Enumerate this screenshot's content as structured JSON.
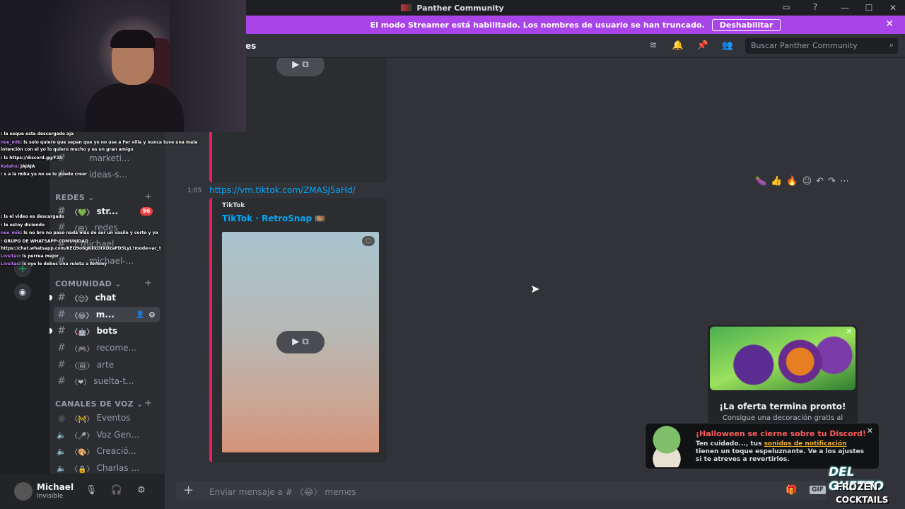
{
  "window": {
    "title": "Panther Community",
    "controls": [
      "—",
      "☐",
      "✕"
    ]
  },
  "banner": {
    "text": "El modo Streamer está habilitado. Los nombres de usuario se han truncado.",
    "button_label": "Deshabilitar",
    "close": "✕"
  },
  "header": {
    "channel_name": "es",
    "search_placeholder": "Buscar Panther Community",
    "icons": [
      "threads-icon",
      "bell-icon",
      "pin-icon",
      "members-icon",
      "search-icon"
    ]
  },
  "sidebar": {
    "top_channels": [
      {
        "label": "marketi..."
      },
      {
        "label": "ideas-s..."
      }
    ],
    "categories": [
      {
        "label": "REDES ⌄"
      },
      {
        "label": "COMUNIDAD ⌄"
      },
      {
        "label": "CANALES DE VOZ ⌄"
      }
    ],
    "redes_channels": [
      {
        "label": "str...",
        "emoji": "〈💚〉",
        "badge": "96"
      },
      {
        "label": "redes",
        "emoji": "〈▤〉"
      },
      {
        "label": "michael",
        "emoji": "〈"
      },
      {
        "label": "michael-...",
        "emoji": ""
      }
    ],
    "comunidad_channels": [
      {
        "label": "chat",
        "emoji": "〈😊〉"
      },
      {
        "label": "m...",
        "emoji": "〈😂〉"
      },
      {
        "label": "bots",
        "emoji": "〈🤖〉"
      },
      {
        "label": "recome...",
        "emoji": "〈🎮〉"
      },
      {
        "label": "arte",
        "emoji": "〈🖼〉"
      },
      {
        "label": "suelta-t...",
        "emoji": "〈❤〉"
      }
    ],
    "voice_channels": [
      {
        "label": "Eventos",
        "emoji": "〈🚧〉"
      },
      {
        "label": "Voz Gen...",
        "emoji": "〈🎤〉"
      },
      {
        "label": "Creació...",
        "emoji": "〈🎨〉"
      },
      {
        "label": "Charlas ...",
        "emoji": "〈🔒〉"
      }
    ]
  },
  "user": {
    "name": "Michael",
    "status": "Invisible"
  },
  "messages": {
    "time": "1:05",
    "link": "https://vm.tiktok.com/ZMASJ5aHd/",
    "embed_provider": "TikTok",
    "embed_title": "TikTok · RetroSnap 🎞️"
  },
  "composer": {
    "placeholder": "Enviar mensaje a # 〈😂〉 memes",
    "gif_label": "GIF"
  },
  "offer": {
    "title": "¡La oferta termina pronto!",
    "text": "Consigue una decoración gratis al"
  },
  "halloween": {
    "title": "¡Halloween se cierne sobre tu Discord!",
    "text_before": "Ten cuidado..., tus ",
    "link": "sonidos de notificación",
    "text_after": " tienen un toque espeluznante. Ve a los ajustes si te atreves a revertirlos."
  },
  "twitch_chat": [
    {
      "user": "",
      "text": ": la esque esta descargado aja"
    },
    {
      "user": "noe_mik",
      "text": ": ls solo quiero que sepan que yo no use a Fer villa y nunca tuve una mala"
    },
    {
      "user": "",
      "text": "intención con el yo lo quiero mucho y es un gran amigo"
    },
    {
      "user": "",
      "text": ": ls https://discord.gg/F2h"
    },
    {
      "user": "Kalahu",
      "text": ": JAJAJA"
    },
    {
      "user": "",
      "text": ": s a la mika ya no se le puede creer"
    },
    {
      "user": "",
      "text": ": ls el video es descargado"
    },
    {
      "user": "",
      "text": ": le estoy diciendo"
    },
    {
      "user": "noe_mik",
      "text": ": ls no bro no pasó nada más de ser un vasile y corto y ya"
    },
    {
      "user": "",
      "text": ": GRUPO DE WHATSAPP-COMUNIDAD"
    },
    {
      "user": "",
      "text": "https://chat.whatsapp.com/KEQ9o6gKkkDtXDzaPD5LyL?mode=ac_t"
    },
    {
      "user": "Livsitas",
      "text": ": ls perrea mejor"
    },
    {
      "user": "Livsitas",
      "text": ": ls oye le debes una ruleta a Antony"
    }
  ],
  "watermark": {
    "line1": "DEL GHETTO",
    "line2": "FROZEN",
    "line3": "COCKTAILS"
  }
}
